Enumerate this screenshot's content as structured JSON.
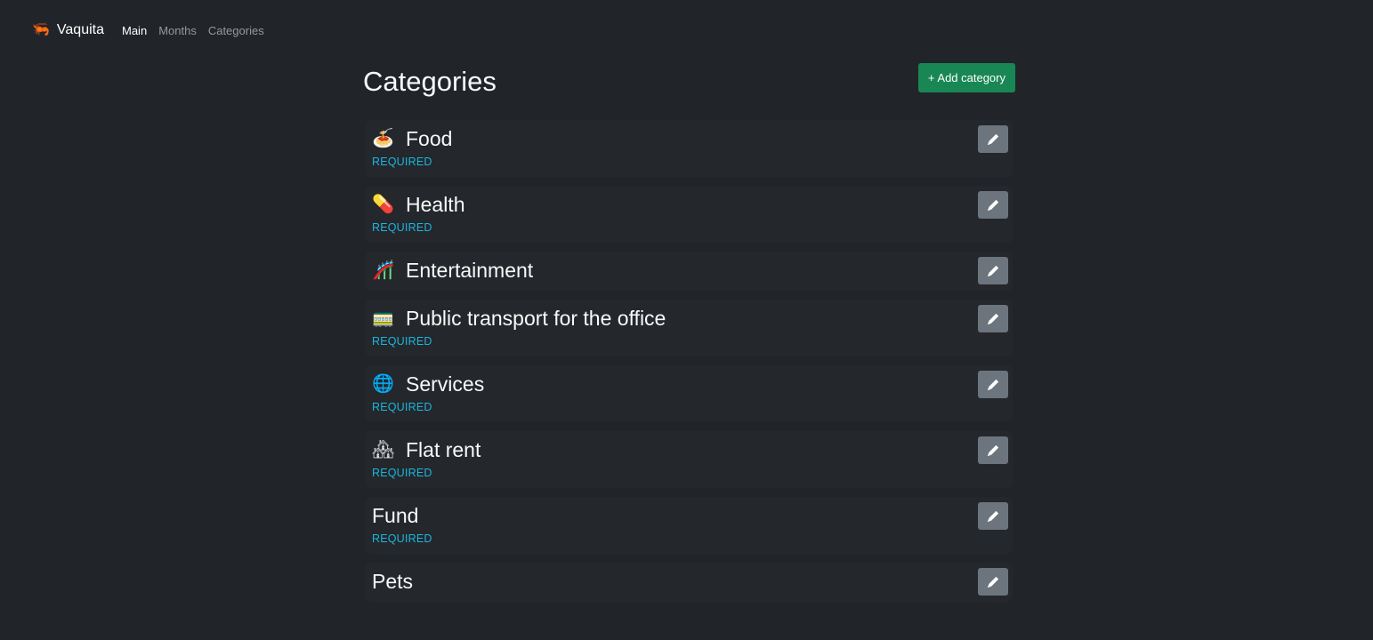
{
  "nav": {
    "brand_icon": "🦐",
    "brand": "Vaquita",
    "links": [
      {
        "label": "Main",
        "active": true
      },
      {
        "label": "Months",
        "active": false
      },
      {
        "label": "Categories",
        "active": false
      }
    ]
  },
  "page": {
    "title": "Categories",
    "add_button": "+ Add category"
  },
  "categories": [
    {
      "emoji": "🍝",
      "name": "Food",
      "badge": "REQUIRED"
    },
    {
      "emoji": "💊",
      "name": "Health",
      "badge": "REQUIRED"
    },
    {
      "emoji": "🎢",
      "name": "Entertainment",
      "badge": ""
    },
    {
      "emoji": "🚃",
      "name": "Public transport for the office",
      "badge": "REQUIRED"
    },
    {
      "emoji": "🌐",
      "name": "Services",
      "badge": "REQUIRED"
    },
    {
      "emoji": "🏘",
      "name": "Flat rent",
      "badge": "REQUIRED"
    },
    {
      "emoji": "",
      "name": "Fund",
      "badge": "REQUIRED"
    },
    {
      "emoji": "",
      "name": "Pets",
      "badge": ""
    }
  ],
  "icons": {
    "edit": "pencil-icon"
  },
  "colors": {
    "background": "#212529",
    "success": "#198754",
    "badge": "#1bb6df",
    "edit_button": "#6c757d"
  }
}
